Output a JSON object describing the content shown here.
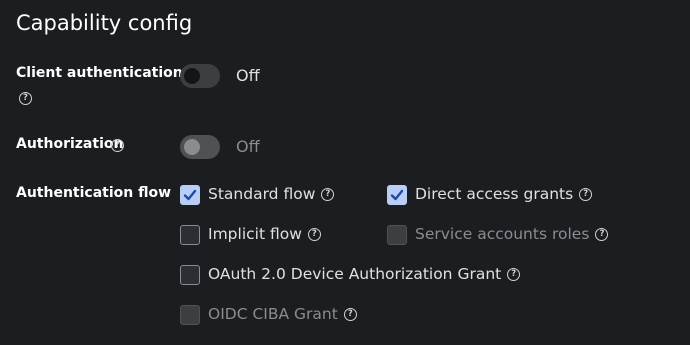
{
  "section": {
    "title": "Capability config"
  },
  "fields": {
    "client_authentication": {
      "label": "Client authentication",
      "state": "Off",
      "help_icon": "question-circle-icon"
    },
    "authorization": {
      "label": "Authorization",
      "state": "Off",
      "help_icon": "question-circle-icon"
    },
    "authentication_flow": {
      "label": "Authentication flow",
      "options": [
        {
          "label": "Standard flow",
          "checked": true,
          "disabled": false
        },
        {
          "label": "Direct access grants",
          "checked": true,
          "disabled": false
        },
        {
          "label": "Implicit flow",
          "checked": false,
          "disabled": false
        },
        {
          "label": "Service accounts roles",
          "checked": false,
          "disabled": true
        },
        {
          "label": "OAuth 2.0 Device Authorization Grant",
          "checked": false,
          "disabled": false
        },
        {
          "label": "OIDC CIBA Grant",
          "checked": false,
          "disabled": true
        }
      ]
    }
  },
  "colors": {
    "background": "#1b1d21",
    "checkbox_checked": "#b9cef4",
    "check_mark": "#1f4ba8",
    "text_primary": "#e0e0e0",
    "text_disabled": "#8a8d90"
  },
  "help_glyph": "?"
}
